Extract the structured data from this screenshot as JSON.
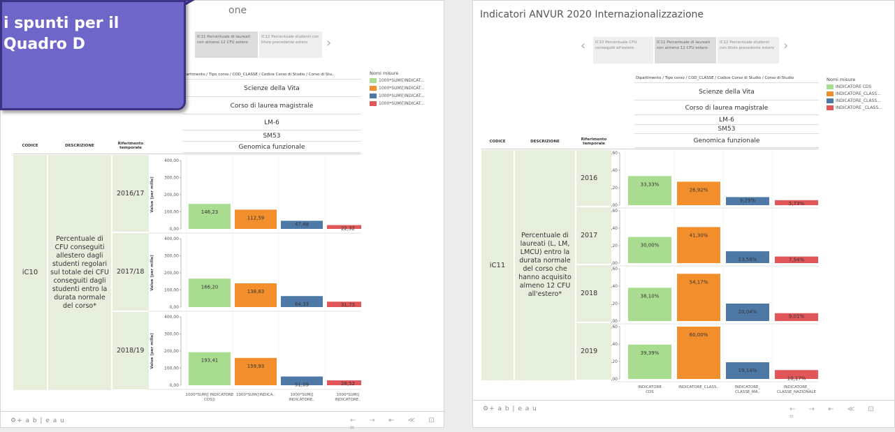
{
  "left": {
    "title_partial": "one",
    "tabs": [
      {
        "label": "IC11 Percentuale di laureati con almeno 12 CFU estero",
        "selected": true
      },
      {
        "label": "IC12 Percentuale studenti con titolo precedente estero",
        "selected": false
      }
    ],
    "header_path": "partimento / Tipo corso / COD_CLASSE / Codice Corso di Studio / Corso di Stu..",
    "header_rows": [
      "Scienze della Vita",
      "Corso di laurea magistrale",
      "LM-6",
      "SM53",
      "Genomica funzionale"
    ],
    "col_codice": "CODICE",
    "col_descrizione": "DESCRIZIONE",
    "col_riferimento": "Riferimento temporale",
    "code": "iC10",
    "description": "Percentuale di CFU conseguiti allestero dagli studenti regolari sul totale dei CFU conseguiti dagli studenti entro la durata normale del corso*",
    "legend_title": "Nomi misure",
    "legend": [
      "1000*SUM([INDICAT...",
      "1000*SUM([INDICAT...",
      "1000*SUM([INDICAT...",
      "1000*SUM([INDICAT..."
    ],
    "x_labels": [
      "1000*SUM([ INDICATORE CDS])",
      "1000*SUM([INDICA..",
      "1000*SUM([ INDICATORE..",
      "1000*SUM([ INDICATORE.."
    ],
    "footer": "⚙+ a b | e a u"
  },
  "right": {
    "title": "Indicatori ANVUR 2020 Internazionalizzazione",
    "tabs": [
      {
        "label": "IC10 Percentuale CFU conseguiti all'estero",
        "selected": false
      },
      {
        "label": "IC11 Percentuale di laureati con almeno 12 CFU estero",
        "selected": true
      },
      {
        "label": "IC12 Percentuale studenti con titolo precedente estero",
        "selected": false
      }
    ],
    "header_path": "Dipartimento / Tipo corso / COD_CLASSE / Codice Corso di Studio / Corso di Studio",
    "header_rows": [
      "Scienze della Vita",
      "Corso di laurea magistrale",
      "LM-6",
      "SM53",
      "Genomica funzionale"
    ],
    "col_codice": "CODICE",
    "col_descrizione": "DESCRIZIONE",
    "col_riferimento": "Riferimento temporale",
    "code": "iC11",
    "description": "Percentuale di laureati (L, LM, LMCU) entro la durata normale del corso che hanno acquisito almeno 12 CFU all'estero*",
    "legend_title": "Nomi misure",
    "legend": [
      "INDICATORE CDS",
      "INDICATORE_CLASS...",
      "INDICATORE_CLASS...",
      "INDICATORE _CLASS..."
    ],
    "x_labels": [
      "INDICATORE CDS",
      "INDICATORE_CLASS..",
      "INDICATORE_ CLASSE_MA..",
      "INDICATORE_ CLASSE_NAZIONALE"
    ],
    "footer": "⚙+ a b | e a u"
  },
  "bubble": {
    "line1": "i spunti per il",
    "line2": "Quadro D"
  },
  "colors": {
    "green": "#a8dd8f",
    "orange": "#f28e2b",
    "blue": "#4e79a7",
    "red": "#e15759",
    "code_bg": "#e6efdc"
  },
  "chart_data": [
    {
      "type": "bar",
      "title": "",
      "ylabel": "Value [per mille]",
      "ylim": [
        0,
        400
      ],
      "yticks": [
        "0,00",
        "100,00",
        "200,00",
        "300,00",
        "400,00"
      ],
      "categories": [
        "2016/17",
        "2017/18",
        "2018/19"
      ],
      "series": [
        {
          "values": [
            146.23,
            166.2,
            193.41
          ],
          "labels": [
            "146,23",
            "166,20",
            "193,41"
          ],
          "color": "#a8dd8f"
        },
        {
          "values": [
            112.59,
            138.83,
            159.93
          ],
          "labels": [
            "112,59",
            "138,83",
            "159,93"
          ],
          "color": "#f28e2b"
        },
        {
          "values": [
            47.48,
            64.33,
            51.09
          ],
          "labels": [
            "47,48",
            "64,33",
            "51,09"
          ],
          "color": "#4e79a7"
        },
        {
          "values": [
            22.32,
            31.73,
            28.52
          ],
          "labels": [
            "22,32",
            "31,73",
            "28,52"
          ],
          "color": "#e15759"
        }
      ]
    },
    {
      "type": "bar",
      "title": "",
      "ylabel": "Value [per mille]",
      "ylim": [
        0,
        0.6
      ],
      "yticks": [
        "0,00",
        "0,20",
        "0,40",
        "0,60"
      ],
      "categories": [
        "2016",
        "2017",
        "2018",
        "2019"
      ],
      "series": [
        {
          "name": "INDICATORE CDS",
          "values": [
            0.3333,
            0.3,
            0.381,
            0.3939
          ],
          "labels": [
            "33,33%",
            "30,00%",
            "38,10%",
            "39,39%"
          ],
          "color": "#a8dd8f"
        },
        {
          "values": [
            0.2692,
            0.413,
            0.5417,
            0.6
          ],
          "labels": [
            "26,92%",
            "41,30%",
            "54,17%",
            "60,00%"
          ],
          "color": "#f28e2b"
        },
        {
          "values": [
            0.0929,
            0.1358,
            0.2004,
            0.1914
          ],
          "labels": [
            "9,29%",
            "13,58%",
            "20,04%",
            "19,14%"
          ],
          "color": "#4e79a7"
        },
        {
          "values": [
            0.0573,
            0.0754,
            0.0901,
            0.1017
          ],
          "labels": [
            "5,73%",
            "7,54%",
            "9,01%",
            "10,17%"
          ],
          "color": "#e15759"
        }
      ]
    }
  ]
}
